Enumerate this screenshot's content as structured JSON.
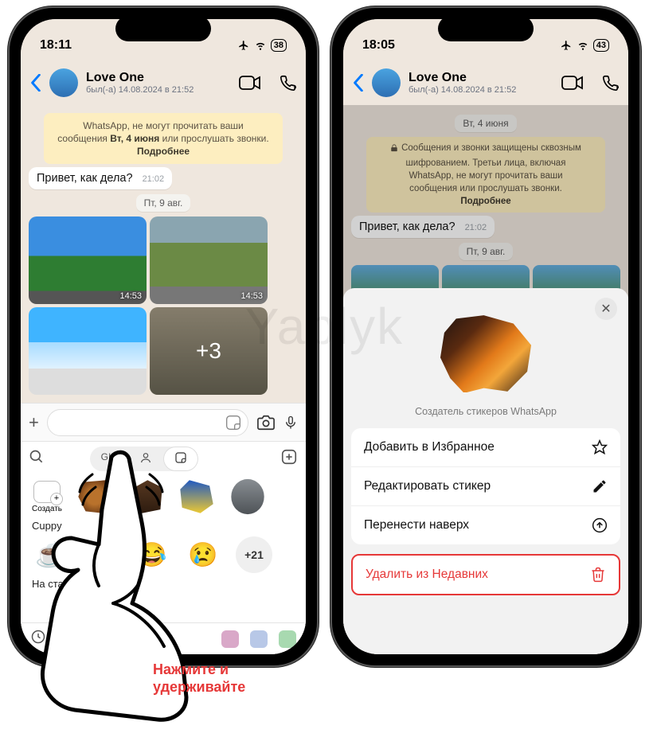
{
  "watermark": "Yablyk",
  "left": {
    "status": {
      "time": "18:11",
      "battery": "38"
    },
    "chat": {
      "name": "Love One",
      "last_seen": "был(-а) 14.08.2024 в 21:52"
    },
    "banner_top": {
      "t": "WhatsApp, не могут прочитать ваши",
      "mid": "сообщения",
      "date": "Вт, 4 июня",
      "t2": "или прослушать звонки.",
      "more": "Подробнее"
    },
    "msg": {
      "text": "Привет, как дела?",
      "time": "21:02"
    },
    "date2": "Пт, 9 авг.",
    "media_time": "14:53",
    "media_more": "+3",
    "sticker_tabs": {
      "gif": "GIF"
    },
    "create": "Создать",
    "pack": "Cuppy",
    "more": "+21",
    "bottom_text": "На старт, внима",
    "hint1": "Нажмите и",
    "hint2": "удерживайте"
  },
  "right": {
    "status": {
      "time": "18:05",
      "battery": "43"
    },
    "chat": {
      "name": "Love One",
      "last_seen": "был(-а) 14.08.2024 в 21:52"
    },
    "date1": "Вт, 4 июня",
    "banner": {
      "l1": "Сообщения и звонки защищены сквозным",
      "l2": "шифрованием. Третьи лица, включая",
      "l3": "WhatsApp, не могут прочитать ваши",
      "l4": "сообщения или прослушать звонки.",
      "more": "Подробнее"
    },
    "msg": {
      "text": "Привет, как дела?",
      "time": "21:02"
    },
    "date2": "Пт, 9 авг.",
    "sheet": {
      "caption": "Создатель стикеров WhatsApp",
      "favorite": "Добавить в Избранное",
      "edit": "Редактировать стикер",
      "move_up": "Перенести наверх",
      "delete": "Удалить из Недавних"
    }
  }
}
